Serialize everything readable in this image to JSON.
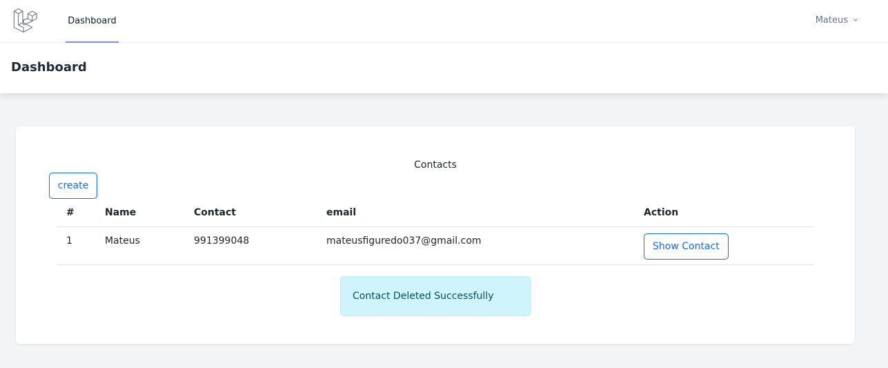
{
  "nav": {
    "logo_icon": "laravel-logo-icon",
    "links": [
      {
        "label": "Dashboard",
        "active": true
      }
    ],
    "user": {
      "name": "Mateus",
      "icon": "chevron-down-icon"
    },
    "active_underline_color": "#818cf8"
  },
  "header": {
    "title": "Dashboard"
  },
  "contacts_card": {
    "title": "Contacts",
    "create_label": "create",
    "table": {
      "columns": [
        "#",
        "Name",
        "Contact",
        "email",
        "Action"
      ],
      "rows": [
        {
          "num": "1",
          "name": "Mateus",
          "contact": "991399048",
          "email": "mateusfiguredo037@gmail.com",
          "action_label": "Show Contact"
        }
      ]
    },
    "alert": {
      "message": "Contact Deleted Successfully",
      "color": "#cff4fc"
    }
  },
  "colors": {
    "accent": "#0d6efd",
    "background": "#f3f4f6"
  }
}
